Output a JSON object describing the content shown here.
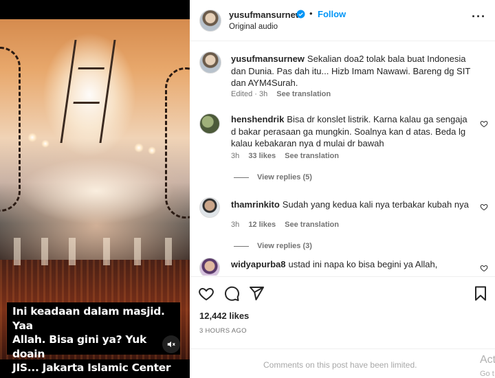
{
  "video": {
    "caption": "Ini keadaan dalam masjid. Yaa\nAllah. Bisa gini ya? Yuk doain\nJIS... Jakarta Islamic Center",
    "mute_icon": "speaker-muted-icon"
  },
  "header": {
    "username": "yusufmansurnew",
    "dot": "•",
    "follow_label": "Follow",
    "audio": "Original audio",
    "more_icon": "more-horizontal-icon",
    "more_label": "···"
  },
  "caption_post": {
    "username": "yusufmansurnew",
    "text": "Sekalian doa2 tolak bala buat Indonesia dan Dunia. Pas dah itu... Hizb Imam Nawawi. Bareng dg SIT dan AYM4Surah.",
    "edited": "Edited · 3h",
    "see_translation": "See translation"
  },
  "comments": [
    {
      "username": "henshendrik",
      "text": "Bisa dr konslet listrik. Karna kalau ga sengaja d bakar perasaan ga mungkin. Soalnya kan d atas. Beda lg kalau kebakaran nya d mulai dr bawah",
      "time": "3h",
      "likes": "33 likes",
      "see_translation": "See translation",
      "view_replies": "View replies (5)"
    },
    {
      "username": "thamrinkito",
      "text": "Sudah yang kedua kali nya terbakar kubah nya",
      "time": "3h",
      "likes": "12 likes",
      "see_translation": "See translation",
      "view_replies": "View replies (3)"
    },
    {
      "username": "widyapurba8",
      "text": "ustad ini napa ko bisa begini ya Allah,"
    }
  ],
  "actions": {
    "like_icon": "heart-icon",
    "comment_icon": "comment-icon",
    "share_icon": "send-icon",
    "save_icon": "bookmark-icon",
    "likes": "12,442 likes",
    "time_ago": "3 HOURS AGO"
  },
  "footer": {
    "limited": "Comments on this post have been limited.",
    "watermark_1": "Act",
    "watermark_2": "Go t"
  },
  "colors": {
    "link": "#0095f6",
    "verified": "#0095f6",
    "secondary_text": "#737373"
  }
}
